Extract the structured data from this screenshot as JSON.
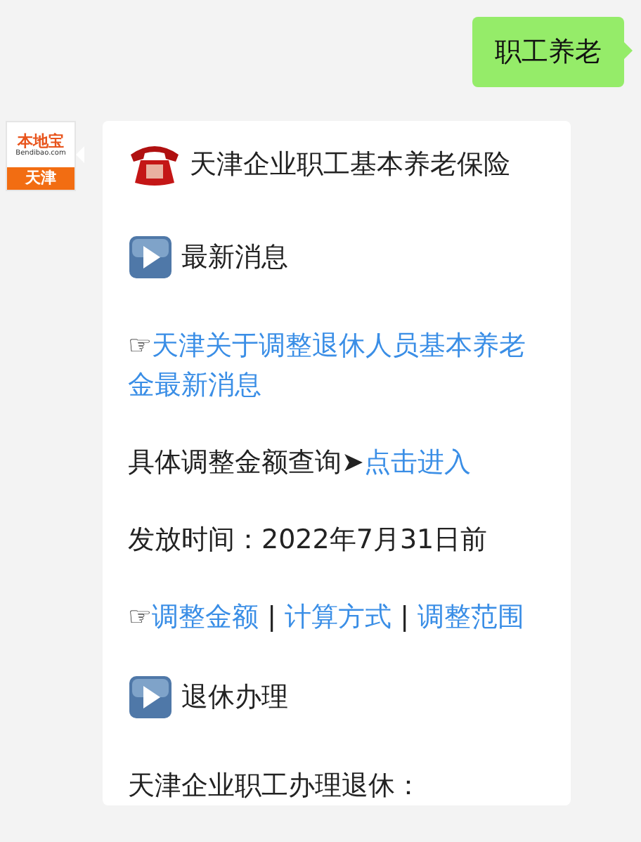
{
  "chat": {
    "messages": [
      {
        "kind": "outgoing-text",
        "text": "职工养老"
      },
      {
        "kind": "incoming-card",
        "avatar": {
          "logo": "本地宝",
          "domain": "Bendibao.com",
          "city": "天津"
        },
        "blocks": [
          {
            "kind": "phone-heading",
            "segments": [
              {
                "text": "天津企业职工基本养老保险",
                "link": false
              }
            ]
          },
          {
            "kind": "play-heading",
            "segments": [
              {
                "text": "最新消息",
                "link": false
              }
            ]
          },
          {
            "kind": "paragraph",
            "segments": [
              {
                "text": "☞",
                "link": false
              },
              {
                "text": "天津关于调整退休人员基本养老金最新消息",
                "link": true
              }
            ]
          },
          {
            "kind": "paragraph",
            "segments": [
              {
                "text": "具体调整金额查询➤",
                "link": false
              },
              {
                "text": "点击进入",
                "link": true
              }
            ]
          },
          {
            "kind": "paragraph",
            "segments": [
              {
                "text": "发放时间：2022年7月31日前",
                "link": false
              }
            ]
          },
          {
            "kind": "paragraph",
            "segments": [
              {
                "text": "☞",
                "link": false
              },
              {
                "text": "调整金额",
                "link": true
              },
              {
                "text": " | ",
                "link": false
              },
              {
                "text": "计算方式",
                "link": true
              },
              {
                "text": " | ",
                "link": false
              },
              {
                "text": "调整范围",
                "link": true
              }
            ]
          },
          {
            "kind": "play-heading",
            "segments": [
              {
                "text": "退休办理",
                "link": false
              }
            ]
          },
          {
            "kind": "paragraph",
            "segments": [
              {
                "text": "天津企业职工办理退休：",
                "link": false
              }
            ]
          }
        ]
      }
    ]
  }
}
